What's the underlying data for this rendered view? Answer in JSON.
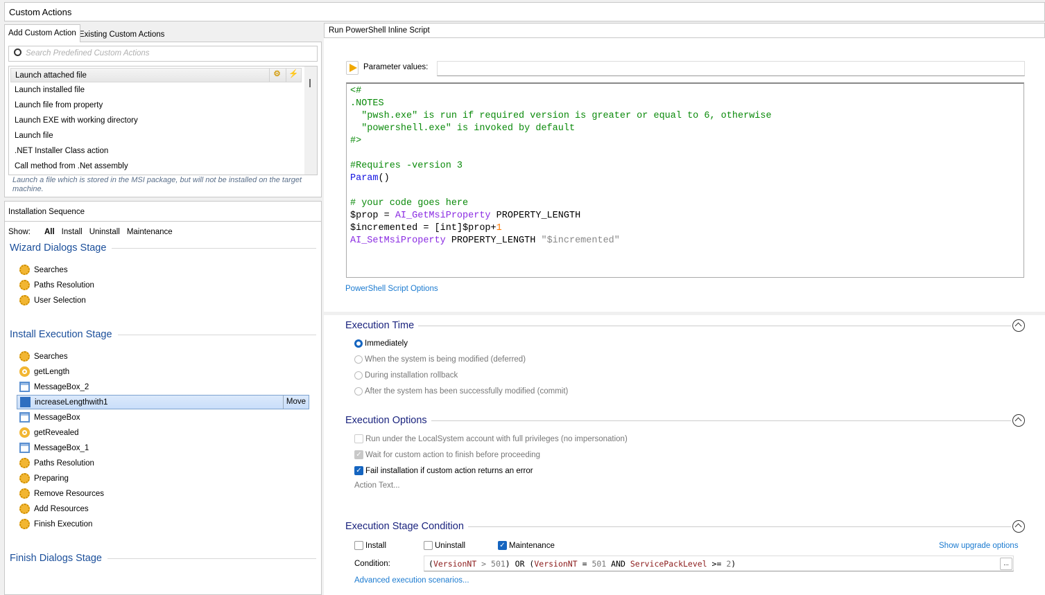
{
  "window": {
    "title": "Custom Actions"
  },
  "tabs": [
    {
      "label": "Add Custom Action",
      "active": true
    },
    {
      "label": "Existing Custom Actions",
      "active": false
    }
  ],
  "search": {
    "placeholder": "Search Predefined Custom Actions",
    "icon": "search-icon"
  },
  "predefined": {
    "items": [
      "Launch attached file",
      "Launch installed file",
      "Launch file from property",
      "Launch EXE with working directory",
      "Launch file",
      ".NET Installer Class action",
      "Call method from .Net assembly"
    ],
    "selected": 0,
    "description": "Launch a file which is stored in the MSI package, but will not be installed on the target machine."
  },
  "sequence": {
    "title": "Installation Sequence",
    "show_label": "Show:",
    "filters": [
      "All",
      "Install",
      "Uninstall",
      "Maintenance"
    ],
    "active_filter": "All",
    "stages": [
      {
        "name": "Wizard Dialogs Stage",
        "items": [
          {
            "label": "Searches",
            "icon": "standard-action"
          },
          {
            "label": "Paths Resolution",
            "icon": "standard-action"
          },
          {
            "label": "User Selection",
            "icon": "standard-action"
          }
        ]
      },
      {
        "name": "Install Execution Stage",
        "items": [
          {
            "label": "Searches",
            "icon": "standard-action"
          },
          {
            "label": "getLength",
            "icon": "custom-action"
          },
          {
            "label": "MessageBox_2",
            "icon": "messagebox"
          },
          {
            "label": "increaseLengthwith1",
            "icon": "powershell",
            "selected": true
          },
          {
            "label": "MessageBox",
            "icon": "messagebox"
          },
          {
            "label": "getRevealed",
            "icon": "custom-action"
          },
          {
            "label": "MessageBox_1",
            "icon": "messagebox"
          },
          {
            "label": "Paths Resolution",
            "icon": "standard-action"
          },
          {
            "label": "Preparing",
            "icon": "standard-action"
          },
          {
            "label": "Remove Resources",
            "icon": "standard-action"
          },
          {
            "label": "Add Resources",
            "icon": "standard-action"
          },
          {
            "label": "Finish Execution",
            "icon": "standard-action"
          }
        ]
      },
      {
        "name": "Finish Dialogs Stage",
        "items": []
      }
    ],
    "move_label": "Move"
  },
  "editor": {
    "title": "Run PowerShell Inline Script",
    "param_label": "Parameter values:",
    "param_value": "",
    "options_link": "PowerShell Script Options",
    "code": [
      [
        [
          "cm",
          "<#"
        ]
      ],
      [
        [
          "cm",
          ".NOTES"
        ]
      ],
      [
        [
          "cm",
          "  \"pwsh.exe\" is run if required version is greater or equal to 6, otherwise"
        ]
      ],
      [
        [
          "cm",
          "  \"powershell.exe\" is invoked by default"
        ]
      ],
      [
        [
          "cm",
          "#>"
        ]
      ],
      [],
      [
        [
          "cm",
          "#Requires -version 3"
        ]
      ],
      [
        [
          "kw",
          "Param"
        ],
        [
          "tx",
          "()"
        ]
      ],
      [],
      [
        [
          "cm",
          "# your code goes here"
        ]
      ],
      [
        [
          "tx",
          "$prop = "
        ],
        [
          "fn",
          "AI_GetMsiProperty"
        ],
        [
          "tx",
          " PROPERTY_LENGTH"
        ]
      ],
      [
        [
          "tx",
          "$incremented = [int]$prop+"
        ],
        [
          "nm",
          "1"
        ]
      ],
      [
        [
          "fn",
          "AI_SetMsiProperty"
        ],
        [
          "tx",
          " PROPERTY_LENGTH "
        ],
        [
          "st",
          "\"$incremented\""
        ]
      ]
    ]
  },
  "execution_time": {
    "title": "Execution Time",
    "options": [
      {
        "label": "Immediately",
        "selected": true
      },
      {
        "label": "When the system is being modified (deferred)"
      },
      {
        "label": "During installation rollback"
      },
      {
        "label": "After the system has been successfully modified (commit)"
      }
    ]
  },
  "execution_options": {
    "title": "Execution Options",
    "options": [
      {
        "label": "Run under the LocalSystem account with full privileges (no impersonation)",
        "checked": false,
        "disabled": true
      },
      {
        "label": "Wait for custom action to finish before proceeding",
        "checked": true,
        "disabled": true
      },
      {
        "label": "Fail installation if custom action returns an error",
        "checked": true,
        "disabled": false
      }
    ],
    "action_text": "Action Text..."
  },
  "stage_condition": {
    "title": "Execution Stage Condition",
    "checks": [
      {
        "label": "Install",
        "checked": false
      },
      {
        "label": "Uninstall",
        "checked": false
      },
      {
        "label": "Maintenance",
        "checked": true
      }
    ],
    "upgrade_link": "Show upgrade options",
    "condition_label": "Condition:",
    "condition": [
      [
        "tx",
        "("
      ],
      [
        "cv",
        "VersionNT"
      ],
      [
        "cn",
        " > 501"
      ],
      [
        "tx",
        ") OR ("
      ],
      [
        "cv",
        "VersionNT"
      ],
      [
        "tx",
        " = "
      ],
      [
        "cn",
        "501"
      ],
      [
        "tx",
        " AND "
      ],
      [
        "cv",
        "ServicePackLevel"
      ],
      [
        "tx",
        " >= "
      ],
      [
        "cn",
        "2"
      ],
      [
        "tx",
        ")"
      ]
    ],
    "condition_button": "...",
    "advanced_link": "Advanced execution scenarios..."
  },
  "colors": {
    "accent": "#1565c0",
    "stage_heading": "#1a4e9a",
    "section_heading": "#1a237e",
    "link": "#1a7ad0"
  }
}
